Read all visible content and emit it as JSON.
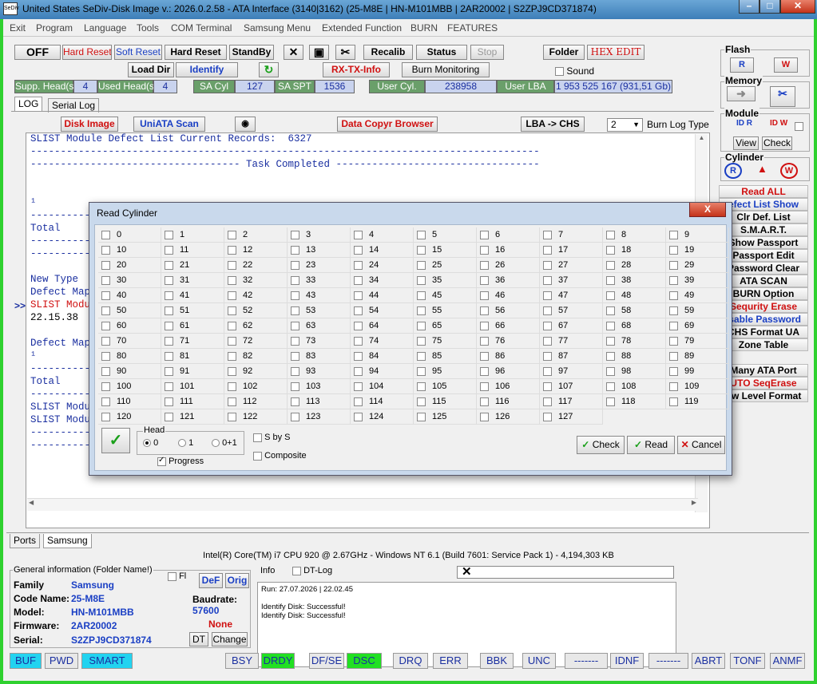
{
  "window": {
    "title": "United States  SeDiv-Disk Image v.: 2026.0.2.58 - ATA Interface (3140|3162)  (25-M8E | HN-M101MBB | 2AR20002 | S2ZPJ9CD371874)",
    "icon_text": "SeDiv"
  },
  "menu": [
    "Exit",
    "Program",
    "Language",
    "Tools",
    "COM Terminal",
    "Samsung Menu",
    "Extended Function",
    "BURN",
    "FEATURES"
  ],
  "toolbar": {
    "off": "OFF",
    "hard_reset1": "Hard Reset",
    "soft_reset": "Soft Reset",
    "hard_reset2": "Hard Reset",
    "standby": "StandBy",
    "recalib": "Recalib",
    "status": "Status",
    "stop": "Stop",
    "folder": "Folder",
    "hex_edit": "HEX EDIT",
    "load_dir": "Load Dir",
    "identify": "Identify",
    "rx_tx": "RX-TX-Info",
    "burn_monitoring": "Burn Monitoring",
    "sound": "Sound"
  },
  "drive_info": [
    {
      "label": "Supp. Head(s)",
      "value": "4"
    },
    {
      "label": "Used Head(s)",
      "value": "4"
    },
    {
      "label": "SA Cyl",
      "value": "127"
    },
    {
      "label": "SA SPT",
      "value": "1536"
    },
    {
      "label": "User Cyl.",
      "value": "238958"
    },
    {
      "label": "User LBA",
      "value": "1 953 525 167  (931,51 Gb)"
    }
  ],
  "tabs": {
    "log": "LOG",
    "serial_log": "Serial Log"
  },
  "subtoolbar": {
    "disk_image": "Disk Image",
    "uniata_scan": "UniATA Scan",
    "data_copyr": "Data Copyr Browser",
    "lba_chs": "LBA -> CHS",
    "burn_count": "2",
    "burn_log_type": "Burn Log Type"
  },
  "log": {
    "line1": "SLIST Module Defect List Current Records:  6327",
    "line2": "-------------------------------------------------------------------------------------",
    "line3": "----------------------------------- Task Completed ----------------------------------",
    "frag_total1": "Total",
    "frag_new_type": "New Type",
    "frag_defect_map1": "Defect Map",
    "frag_slist1": "SLIST Modu",
    "frag_time": "22.15.38",
    "frag_defect_map2": "Defect Map",
    "frag_total2": "Total",
    "frag_slist2": "SLIST Modu",
    "frag_slist3": "SLIST Modu",
    "frag_arrow": ">>",
    "dash_short": "----------"
  },
  "right_panel": {
    "flash": "Flash",
    "memory": "Memory",
    "module": "Module",
    "view": "View",
    "check": "Check",
    "cylinder": "Cylinder",
    "buttons": [
      {
        "label": "Read ALL",
        "color": "red"
      },
      {
        "label": "efect List Show",
        "color": "blue"
      },
      {
        "label": "Clr Def. List",
        "color": "black"
      },
      {
        "label": "S.M.A.R.T.",
        "color": "black"
      },
      {
        "label": "Show Passport",
        "color": "black"
      },
      {
        "label": "Passport Edit",
        "color": "black"
      },
      {
        "label": "Password Clear",
        "color": "black"
      },
      {
        "label": "ATA SCAN",
        "color": "black"
      },
      {
        "label": "BURN Option",
        "color": "black"
      },
      {
        "label": "Sequrity Erase",
        "color": "red"
      },
      {
        "label": "isable Password",
        "color": "blue"
      },
      {
        "label": "CHS Format UA",
        "color": "black"
      },
      {
        "label": "Zone Table",
        "color": "black"
      },
      {
        "label": "Many ATA Port",
        "color": "black"
      },
      {
        "label": "UTO SeqErase",
        "color": "red"
      },
      {
        "label": "ow Level Format",
        "color": "black"
      }
    ]
  },
  "bottom_tabs": {
    "ports": "Ports",
    "samsung": "Samsung"
  },
  "cpu_info": "Intel(R) Core(TM) i7 CPU 920  @ 2.67GHz - Windows NT 6.1 (Build 7601: Service Pack 1) -  4,194,303 KB",
  "general": {
    "title": "General information (Folder Name!)",
    "fl_label": "Fl",
    "def": "DeF",
    "orig": "Orig",
    "family_label": "Family",
    "family": "Samsung",
    "code_label": "Code Name:",
    "code": "25-M8E",
    "model_label": "Model:",
    "model": "HN-M101MBB",
    "firmware_label": "Firmware:",
    "firmware": "2AR20002",
    "serial_label": "Serial:",
    "serial": "S2ZPJ9CD371874",
    "baud_label": "Baudrate:",
    "baud": "57600",
    "none": "None",
    "dt": "DT",
    "change": "Change"
  },
  "info_panel": {
    "title": "Info",
    "dt_log": "DT-Log",
    "run": "Run: 27.07.2026  |  22.02.45",
    "line1": "Identify Disk: Successful!",
    "line2": "Identify Disk: Successful!"
  },
  "status_bar": [
    {
      "label": "BUF",
      "state": "cyan"
    },
    {
      "label": "PWD",
      "state": "off"
    },
    {
      "label": "SMART",
      "state": "cyan"
    },
    {
      "label": "BSY",
      "state": "off"
    },
    {
      "label": "DRDY",
      "state": "green"
    },
    {
      "label": "DF/SE",
      "state": "off"
    },
    {
      "label": "DSC",
      "state": "green"
    },
    {
      "label": "DRQ",
      "state": "off"
    },
    {
      "label": "ERR",
      "state": "off"
    },
    {
      "label": "BBK",
      "state": "off"
    },
    {
      "label": "UNC",
      "state": "off"
    },
    {
      "label": "-------",
      "state": "off"
    },
    {
      "label": "IDNF",
      "state": "off"
    },
    {
      "label": "-------",
      "state": "off"
    },
    {
      "label": "ABRT",
      "state": "off"
    },
    {
      "label": "TONF",
      "state": "off"
    },
    {
      "label": "ANMF",
      "state": "off"
    }
  ],
  "dialog": {
    "title": "Read Cylinder",
    "close": "X",
    "cylinders": [
      "0",
      "1",
      "2",
      "3",
      "4",
      "5",
      "6",
      "7",
      "8",
      "9",
      "10",
      "11",
      "12",
      "13",
      "14",
      "15",
      "16",
      "17",
      "18",
      "19",
      "20",
      "21",
      "22",
      "23",
      "24",
      "25",
      "26",
      "27",
      "28",
      "29",
      "30",
      "31",
      "32",
      "33",
      "34",
      "35",
      "36",
      "37",
      "38",
      "39",
      "40",
      "41",
      "42",
      "43",
      "44",
      "45",
      "46",
      "47",
      "48",
      "49",
      "50",
      "51",
      "52",
      "53",
      "54",
      "55",
      "56",
      "57",
      "58",
      "59",
      "60",
      "61",
      "62",
      "63",
      "64",
      "65",
      "66",
      "67",
      "68",
      "69",
      "70",
      "71",
      "72",
      "73",
      "74",
      "75",
      "76",
      "77",
      "78",
      "79",
      "80",
      "81",
      "82",
      "83",
      "84",
      "85",
      "86",
      "87",
      "88",
      "89",
      "90",
      "91",
      "92",
      "93",
      "94",
      "95",
      "96",
      "97",
      "98",
      "99",
      "100",
      "101",
      "102",
      "103",
      "104",
      "105",
      "106",
      "107",
      "108",
      "109",
      "110",
      "111",
      "112",
      "113",
      "114",
      "115",
      "116",
      "117",
      "118",
      "119",
      "120",
      "121",
      "122",
      "123",
      "124",
      "125",
      "126",
      "127"
    ],
    "head_label": "Head",
    "head_options": [
      "0",
      "1",
      "0+1"
    ],
    "progress": "Progress",
    "s_by_s": "S by S",
    "composite": "Composite",
    "check": "Check",
    "read": "Read",
    "cancel": "Cancel"
  }
}
